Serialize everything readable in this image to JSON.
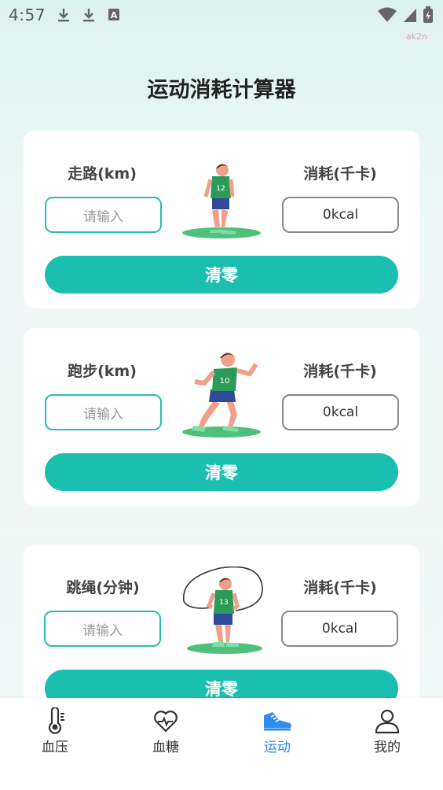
{
  "status_bar": {
    "time": "4:57",
    "tag": "ak2n"
  },
  "page": {
    "title": "运动消耗计算器"
  },
  "cards": [
    {
      "activity_label": "走路(km)",
      "input_placeholder": "请输入",
      "result_label": "消耗(千卡)",
      "result_value": "0kcal",
      "clear_label": "清零"
    },
    {
      "activity_label": "跑步(km)",
      "input_placeholder": "请输入",
      "result_label": "消耗(千卡)",
      "result_value": "0kcal",
      "clear_label": "清零"
    },
    {
      "activity_label": "跳绳(分钟)",
      "input_placeholder": "请输入",
      "result_label": "消耗(千卡)",
      "result_value": "0kcal",
      "clear_label": "清零"
    }
  ],
  "bottom_nav": {
    "items": [
      {
        "label": "血压",
        "icon": "thermometer-icon",
        "active": false
      },
      {
        "label": "血糖",
        "icon": "heart-pulse-icon",
        "active": false
      },
      {
        "label": "运动",
        "icon": "sneaker-icon",
        "active": true
      },
      {
        "label": "我的",
        "icon": "person-icon",
        "active": false
      }
    ]
  },
  "colors": {
    "accent": "#1bbfb0",
    "nav_active": "#2f8df0"
  }
}
